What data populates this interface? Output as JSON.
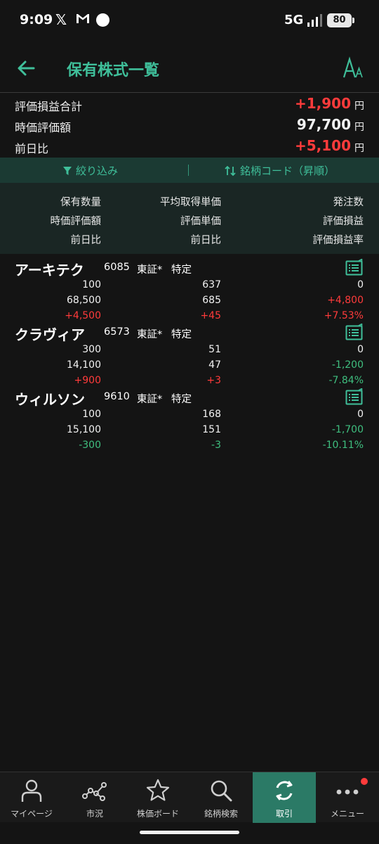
{
  "status_bar": {
    "time": "9:09",
    "network": "5G",
    "battery": "80"
  },
  "header": {
    "title": "保有株式一覧"
  },
  "summary": {
    "rows": [
      {
        "label": "評価損益合計",
        "value": "+1,900",
        "unit": "円",
        "color": "#ff3b3b"
      },
      {
        "label": "時価評価額",
        "value": "97,700",
        "unit": "円",
        "color": "#f2f2f2"
      },
      {
        "label": "前日比",
        "value": "+5,100",
        "unit": "円",
        "color": "#ff3b3b"
      }
    ]
  },
  "filter_bar": {
    "filter_label": "絞り込み",
    "sort_label": "銘柄コード（昇順）"
  },
  "columns": {
    "row1": [
      "保有数量",
      "平均取得単価",
      "発注数"
    ],
    "row2": [
      "時価評価額",
      "評価単価",
      "評価損益"
    ],
    "row3": [
      "前日比",
      "前日比",
      "評価損益率"
    ]
  },
  "holdings": [
    {
      "name": "アーキテク",
      "code": "6085",
      "market": "東証*",
      "account": "特定",
      "rows": [
        [
          "100",
          "637",
          "0"
        ],
        [
          "68,500",
          "685",
          "+4,800"
        ],
        [
          "+4,500",
          "+45",
          "+7.53%"
        ]
      ]
    },
    {
      "name": "クラヴィア",
      "code": "6573",
      "market": "東証*",
      "account": "特定",
      "rows": [
        [
          "300",
          "51",
          "0"
        ],
        [
          "14,100",
          "47",
          "-1,200"
        ],
        [
          "+900",
          "+3",
          "-7.84%"
        ]
      ]
    },
    {
      "name": "ウィルソン",
      "code": "9610",
      "market": "東証*",
      "account": "特定",
      "rows": [
        [
          "100",
          "168",
          "0"
        ],
        [
          "15,100",
          "151",
          "-1,700"
        ],
        [
          "-300",
          "-3",
          "-10.11%"
        ]
      ]
    }
  ],
  "bottom_nav": [
    {
      "label": "マイページ",
      "icon": "person-icon"
    },
    {
      "label": "市況",
      "icon": "market-chart-icon"
    },
    {
      "label": "株価ボード",
      "icon": "star-icon"
    },
    {
      "label": "銘柄検索",
      "icon": "search-icon"
    },
    {
      "label": "取引",
      "icon": "trade-refresh-icon"
    },
    {
      "label": "メニュー",
      "icon": "more-dots-icon"
    }
  ],
  "colors": {
    "accent": "#3fbf9a",
    "positive": "#ff3b3b",
    "negative": "#3fbf7f",
    "active_nav": "#2b7a66"
  }
}
